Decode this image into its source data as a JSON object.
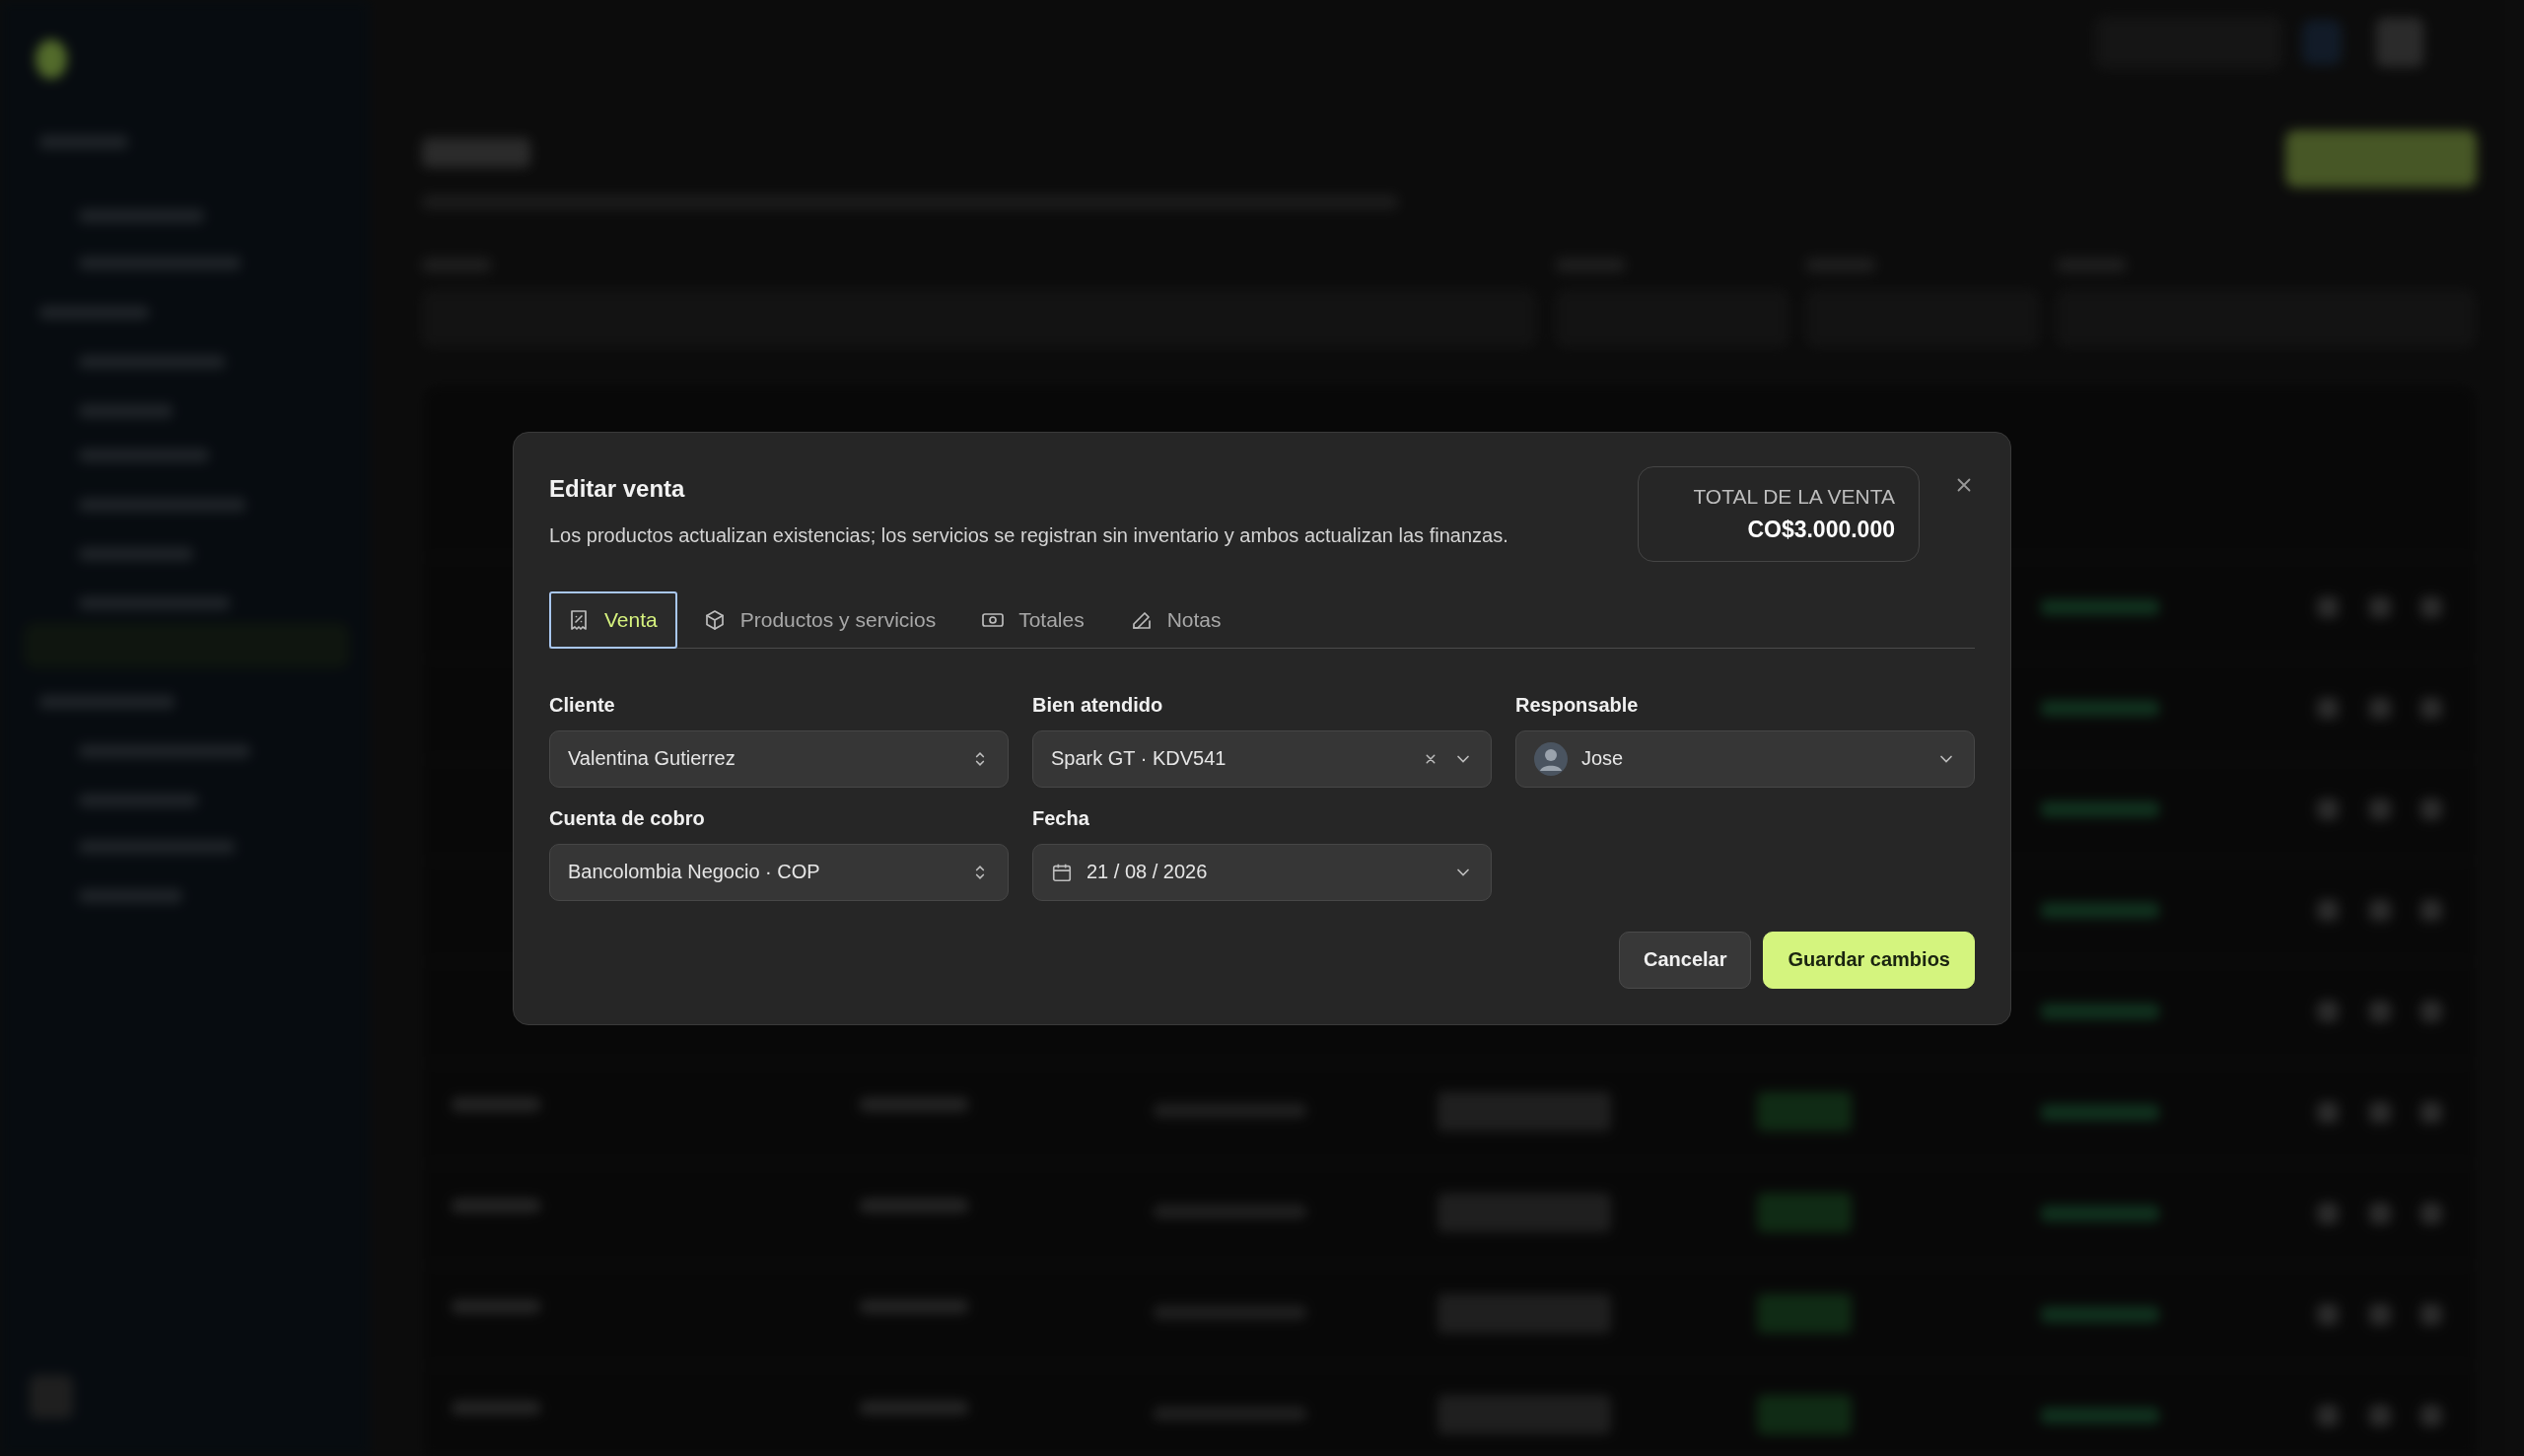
{
  "dialog": {
    "title": "Editar venta",
    "description": "Los productos actualizan existencias; los servicios se registran sin inventario y ambos actualizan las finanzas.",
    "total": {
      "label": "TOTAL DE LA VENTA",
      "value": "CO$3.000.000"
    },
    "tabs": [
      {
        "kind": "receipt",
        "label": "Venta",
        "selected": true
      },
      {
        "kind": "box",
        "label": "Productos y servicios",
        "selected": false
      },
      {
        "kind": "cash",
        "label": "Totales",
        "selected": false
      },
      {
        "kind": "pencil",
        "label": "Notas",
        "selected": false
      }
    ],
    "fields": [
      {
        "kind": "combo",
        "label": "Cliente",
        "value": "Valentina Gutierrez"
      },
      {
        "kind": "clearable",
        "label": "Bien atendido",
        "value": "Spark GT · KDV541"
      },
      {
        "kind": "person",
        "label": "Responsable",
        "value": "Jose"
      },
      {
        "kind": "combo",
        "label": "Cuenta de cobro",
        "value": "Bancolombia Negocio · COP"
      },
      {
        "kind": "date",
        "label": "Fecha",
        "value": "21 / 08 / 2026"
      }
    ],
    "buttons": [
      {
        "kind": "secondary",
        "label": "Cancelar"
      },
      {
        "kind": "primary",
        "label": "Guardar cambios"
      }
    ]
  }
}
